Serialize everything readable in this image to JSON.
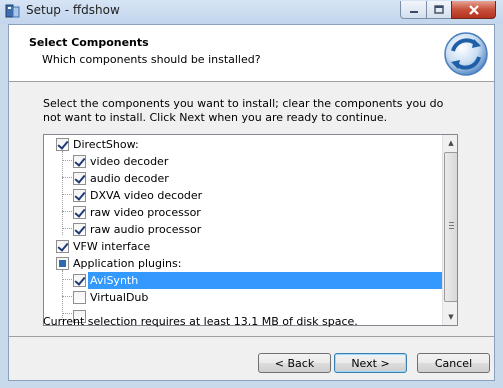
{
  "window": {
    "title": "Setup - ffdshow"
  },
  "header": {
    "title": "Select Components",
    "subtitle": "Which components should be installed?"
  },
  "intro_text": "Select the components you want to install; clear the components you do not want to install. Click Next when you are ready to continue.",
  "components": [
    {
      "label": "DirectShow:",
      "state": "checked",
      "level": 0
    },
    {
      "label": "video decoder",
      "state": "checked",
      "level": 1
    },
    {
      "label": "audio decoder",
      "state": "checked",
      "level": 1
    },
    {
      "label": "DXVA video decoder",
      "state": "checked",
      "level": 1
    },
    {
      "label": "raw video processor",
      "state": "checked",
      "level": 1
    },
    {
      "label": "raw audio processor",
      "state": "checked",
      "level": 1
    },
    {
      "label": "VFW interface",
      "state": "checked",
      "level": 0
    },
    {
      "label": "Application plugins:",
      "state": "partial",
      "level": 0
    },
    {
      "label": "AviSynth",
      "state": "checked",
      "level": 1,
      "selected": true
    },
    {
      "label": "VirtualDub",
      "state": "unchecked",
      "level": 1
    }
  ],
  "disk_space_text": "Current selection requires at least 13.1 MB of disk space.",
  "buttons": {
    "back": "< Back",
    "next": "Next >",
    "cancel": "Cancel"
  },
  "icons": {
    "app": "setup-installer-icon",
    "logo": "ffdshow-logo-icon"
  },
  "colors": {
    "selection": "#3399ff",
    "close_button": "#c7503a"
  }
}
